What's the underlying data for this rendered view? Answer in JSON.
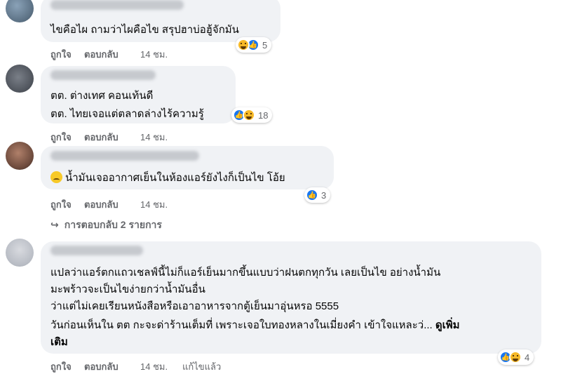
{
  "comments": [
    {
      "lines": [
        "ไขคือไผ ถามว่าไผคือไข สรุปฮาบ่อฮู้จักมัน"
      ],
      "actions": {
        "like": "ถูกใจ",
        "reply": "ตอบกลับ",
        "time": "14 ชม."
      },
      "reactions": {
        "icons": [
          "haha",
          "like"
        ],
        "count": "5"
      }
    },
    {
      "lines": [
        "ตต. ต่างเทศ คอนเท้นดี",
        "ตต. ไทยเจอแต่ตลาดล่างไร้ความรู้"
      ],
      "actions": {
        "like": "ถูกใจ",
        "reply": "ตอบกลับ",
        "time": "14 ชม."
      },
      "reactions": {
        "icons": [
          "like",
          "haha"
        ],
        "count": "18"
      }
    },
    {
      "lines": [
        "น้ำมันเจออากาศเย็นในห้องแอร์ยังไงก็เป็นไข โอ้ย"
      ],
      "actions": {
        "like": "ถูกใจ",
        "reply": "ตอบกลับ",
        "time": "14 ชม."
      },
      "reactions": {
        "icons": [
          "like"
        ],
        "count": "3"
      },
      "replies_label": "การตอบกลับ 2 รายการ"
    },
    {
      "lines": [
        "แปลว่าแอร์ตกแถวเชลฟ์นี้ไม่ก็แอร์เย็นมากขึ้นแบบว่าฝนตกทุกวัน เลยเป็นไข อย่างน้ำมัน",
        "มะพร้าวจะเป็นไขง่ายกว่าน้ำมันอื่น",
        "ว่าแต่ไม่เคยเรียนหนังสือหรือเอาอาหารจากตู้เย็นมาอุ่นหรอ 5555",
        "วันก่อนเห็นใน ตต กะจะด่าร้านเต็มที่ เพราะเจอใบทองหลางในเมี่ยงคำ เข้าใจแหละว่... ",
        "เติม"
      ],
      "see_more": "ดูเพิ่ม",
      "actions": {
        "like": "ถูกใจ",
        "reply": "ตอบกลับ",
        "time": "14 ชม.",
        "edited": "แก้ไขแล้ว"
      },
      "reactions": {
        "icons": [
          "like",
          "haha"
        ],
        "count": "4"
      }
    }
  ]
}
